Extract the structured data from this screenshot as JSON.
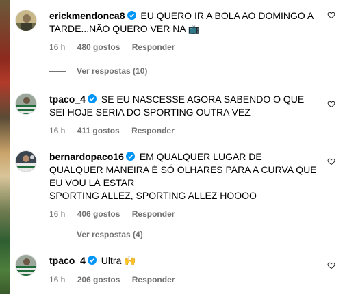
{
  "comments": [
    {
      "username": "erickmendonca8",
      "text": "EU QUERO IR A BOLA AO DOMINGO A TARDE...NÃO QUERO VER NA 📺",
      "time": "16 h",
      "likes": "480 gostos",
      "reply": "Responder",
      "view_replies": "Ver respostas (10)"
    },
    {
      "username": "tpaco_4",
      "text": "SE EU NASCESSE AGORA SABENDO O QUE SEI HOJE SERIA DO SPORTING OUTRA VEZ",
      "time": "16 h",
      "likes": "411 gostos",
      "reply": "Responder"
    },
    {
      "username": "bernardopaco16",
      "text_line1": "EM QUALQUER LUGAR DE QUALQUER MANEIRA É SÓ OLHARES PARA A CURVA QUE EU VOU LÁ ESTAR",
      "text_line2": "SPORTING ALLEZ, SPORTING ALLEZ HOOOO",
      "time": "16 h",
      "likes": "406 gostos",
      "reply": "Responder",
      "view_replies": "Ver respostas (4)"
    },
    {
      "username": "tpaco_4",
      "text": "Ultra 🙌",
      "time": "16 h",
      "likes": "206 gostos",
      "reply": "Responder"
    }
  ],
  "icons": {
    "verified": "verified-badge-icon",
    "like": "heart-outline-icon"
  },
  "colors": {
    "verified_blue": "#0095f6",
    "secondary_text": "#737373"
  }
}
